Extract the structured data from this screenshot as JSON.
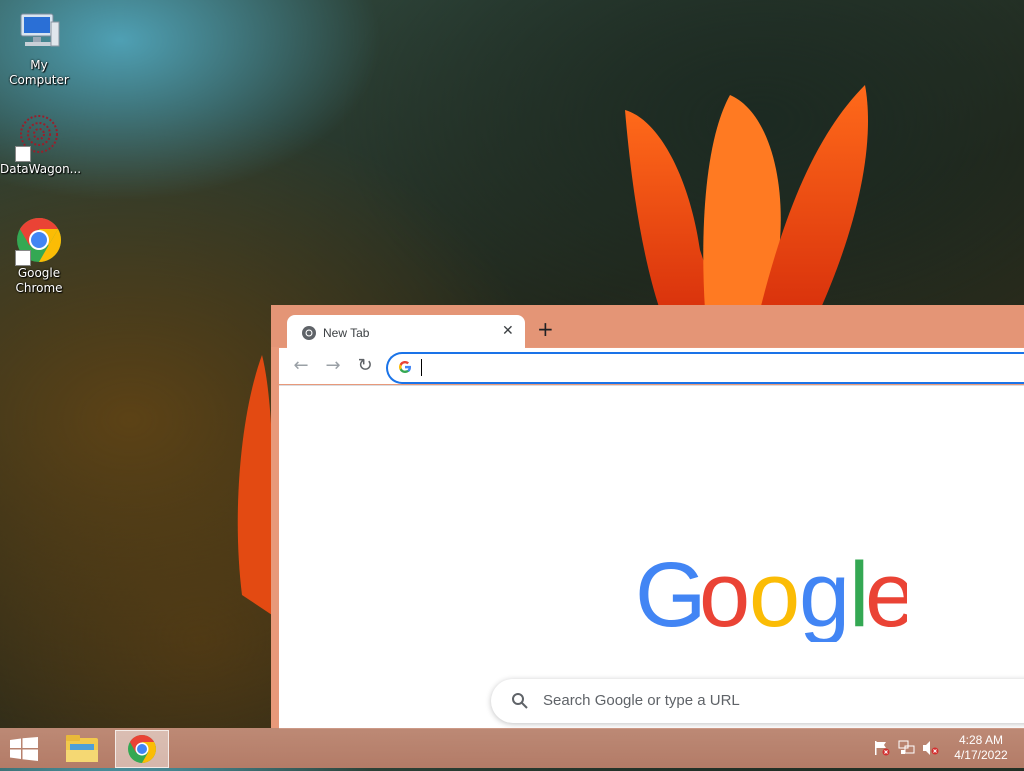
{
  "desktop": {
    "icons": [
      {
        "label": "My Computer",
        "icon": "computer-icon"
      },
      {
        "label": "DataWagon...",
        "icon": "datawagon-icon"
      },
      {
        "label": "Google Chrome",
        "icon": "chrome-icon"
      }
    ]
  },
  "browser": {
    "tab": {
      "title": "New Tab",
      "close": "✕",
      "icon": "chrome-tab-icon"
    },
    "new_tab_label": "+",
    "toolbar": {
      "back": "←",
      "forward": "→",
      "reload": "↻"
    },
    "omnibox": {
      "value": "",
      "icon": "google-g-icon"
    },
    "ntp": {
      "logo_letters": [
        "G",
        "o",
        "o",
        "g",
        "l",
        "e"
      ],
      "search_placeholder": "Search Google or type a URL"
    }
  },
  "taskbar": {
    "start_icon": "windows-logo-icon",
    "apps": [
      {
        "name": "File Explorer",
        "icon": "file-explorer-icon",
        "active": false
      },
      {
        "name": "Google Chrome",
        "icon": "chrome-icon",
        "active": true
      }
    ],
    "tray": [
      "action-center-flag-icon",
      "network-icon",
      "volume-muted-icon"
    ],
    "clock": {
      "time": "4:28 AM",
      "date": "4/17/2022"
    }
  },
  "colors": {
    "browser_frame": "#e49576",
    "omnibox_border": "#1a73e8",
    "google_blue": "#4285f4",
    "google_red": "#ea4335",
    "google_yellow": "#fbbc05",
    "google_green": "#34a853"
  }
}
